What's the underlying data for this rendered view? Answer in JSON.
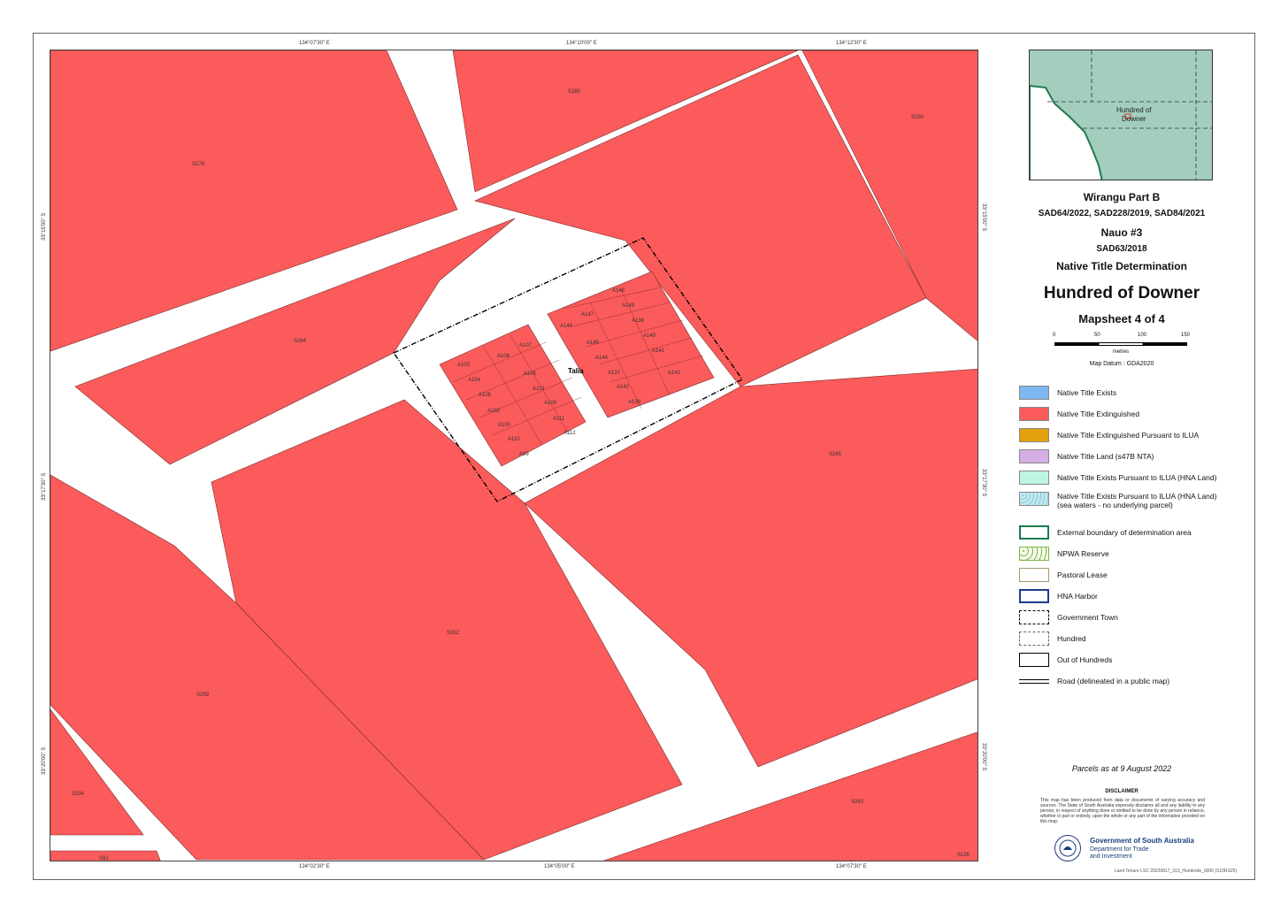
{
  "map": {
    "coords_top": [
      "134°07'30\" E",
      "134°10'00\" E",
      "134°12'30\" E"
    ],
    "coords_bottom": [
      "134°02'30\" E",
      "134°05'00\" E",
      "134°07'30\" E"
    ],
    "coords_left": [
      "33°15'00\" S",
      "33°17'30\" S",
      "33°20'00\" S"
    ],
    "coords_right": [
      "33°15'00\" S",
      "33°17'30\" S",
      "33°20'00\" S"
    ],
    "town_label": "Talia",
    "parcel_labels": [
      "S280",
      "S279",
      "S250",
      "S264",
      "S265",
      "S262",
      "S259",
      "S104",
      "S81",
      "S263",
      "S126",
      "A107",
      "A108",
      "A103",
      "A104",
      "A106",
      "A105",
      "A101",
      "A102",
      "A109",
      "A110",
      "A111",
      "A100",
      "A112",
      "A99",
      "A148",
      "A147",
      "A149",
      "A146",
      "A138",
      "A145",
      "A140",
      "A144",
      "A141",
      "A137",
      "A143",
      "A142",
      "A139",
      "A136"
    ],
    "colors": {
      "extinguished": "#fc5b5b",
      "road": "#ffffff",
      "boundary": "#000000"
    }
  },
  "inset": {
    "label_line1": "Hundred of",
    "label_line2": "Downer",
    "colors": {
      "land": "#a3cdbd",
      "coast": "#1f7a4c",
      "sea": "#ffffff"
    }
  },
  "titles": {
    "line1": "Wirangu Part B",
    "line2": "SAD64/2022, SAD228/2019, SAD84/2021",
    "line3": "Nauo #3",
    "line4": "SAD63/2018",
    "line5": "Native Title Determination",
    "main": "Hundred of Downer",
    "mapsheet": "Mapsheet 4 of 4"
  },
  "scale": {
    "ticks": [
      "0",
      "50",
      "100",
      "150"
    ],
    "unit": "metres"
  },
  "datum": "Map Datum : GDA2020",
  "legend": [
    {
      "label": "Native Title Exists",
      "icon": "fill-swatch",
      "color": "#7fb8f0"
    },
    {
      "label": "Native Title Extinguished",
      "icon": "fill-swatch",
      "color": "#fc5b5b"
    },
    {
      "label": "Native Title Extinguished Pursuant to ILUA",
      "icon": "fill-swatch",
      "color": "#e5a00d"
    },
    {
      "label": "Native Title Land (s47B NTA)",
      "icon": "fill-swatch",
      "color": "#d6aee6"
    },
    {
      "label": "Native Title Exists Pursuant to ILUA (HNA Land)",
      "icon": "fill-swatch",
      "color": "#bff5e0"
    },
    {
      "label": "Native Title Exists Pursuant to ILUA (HNA Land)",
      "label2": "(sea waters - no underlying parcel)",
      "icon": "pattern-swatch",
      "color": "#bfeaf0"
    },
    {
      "label": "External boundary of determination area",
      "icon": "outline-swatch",
      "color": "#1f7a4c"
    },
    {
      "label": "NPWA Reserve",
      "icon": "dotted-swatch",
      "color": "#7ab648"
    },
    {
      "label": "Pastoral Lease",
      "icon": "outline-swatch",
      "color": "#a8996b"
    },
    {
      "label": "HNA Harbor",
      "icon": "outline-swatch",
      "color": "#1a3d8a"
    },
    {
      "label": "Government Town",
      "icon": "dashdot-swatch",
      "color": "#000000"
    },
    {
      "label": "Hundred",
      "icon": "dashed-swatch",
      "color": "#666666"
    },
    {
      "label": "Out of Hundreds",
      "icon": "outline-swatch",
      "color": "#000000"
    },
    {
      "label": "Road (delineated in a public map)",
      "icon": "double-line",
      "color": "#000000"
    }
  ],
  "parcels_note": "Parcels as at 9 August 2022",
  "disclaimer_title": "DISCLAIMER",
  "disclaimer": "This map has been produced from data or documents of varying accuracy and sources. The State of South Australia expressly disclaims all and any liability to any person, in respect of anything done or omitted to be done by any person in reliance, whether in part or entirely, upon the whole or any part of the information provided on this map.",
  "gov": {
    "line1": "Government of South Australia",
    "line2": "Department for Trade",
    "line3": "and Investment",
    "color": "#1a3d7a"
  },
  "doc_id": "Land Tenure LSC 20220817_313_Hundreds_0000 (S10RS25)"
}
